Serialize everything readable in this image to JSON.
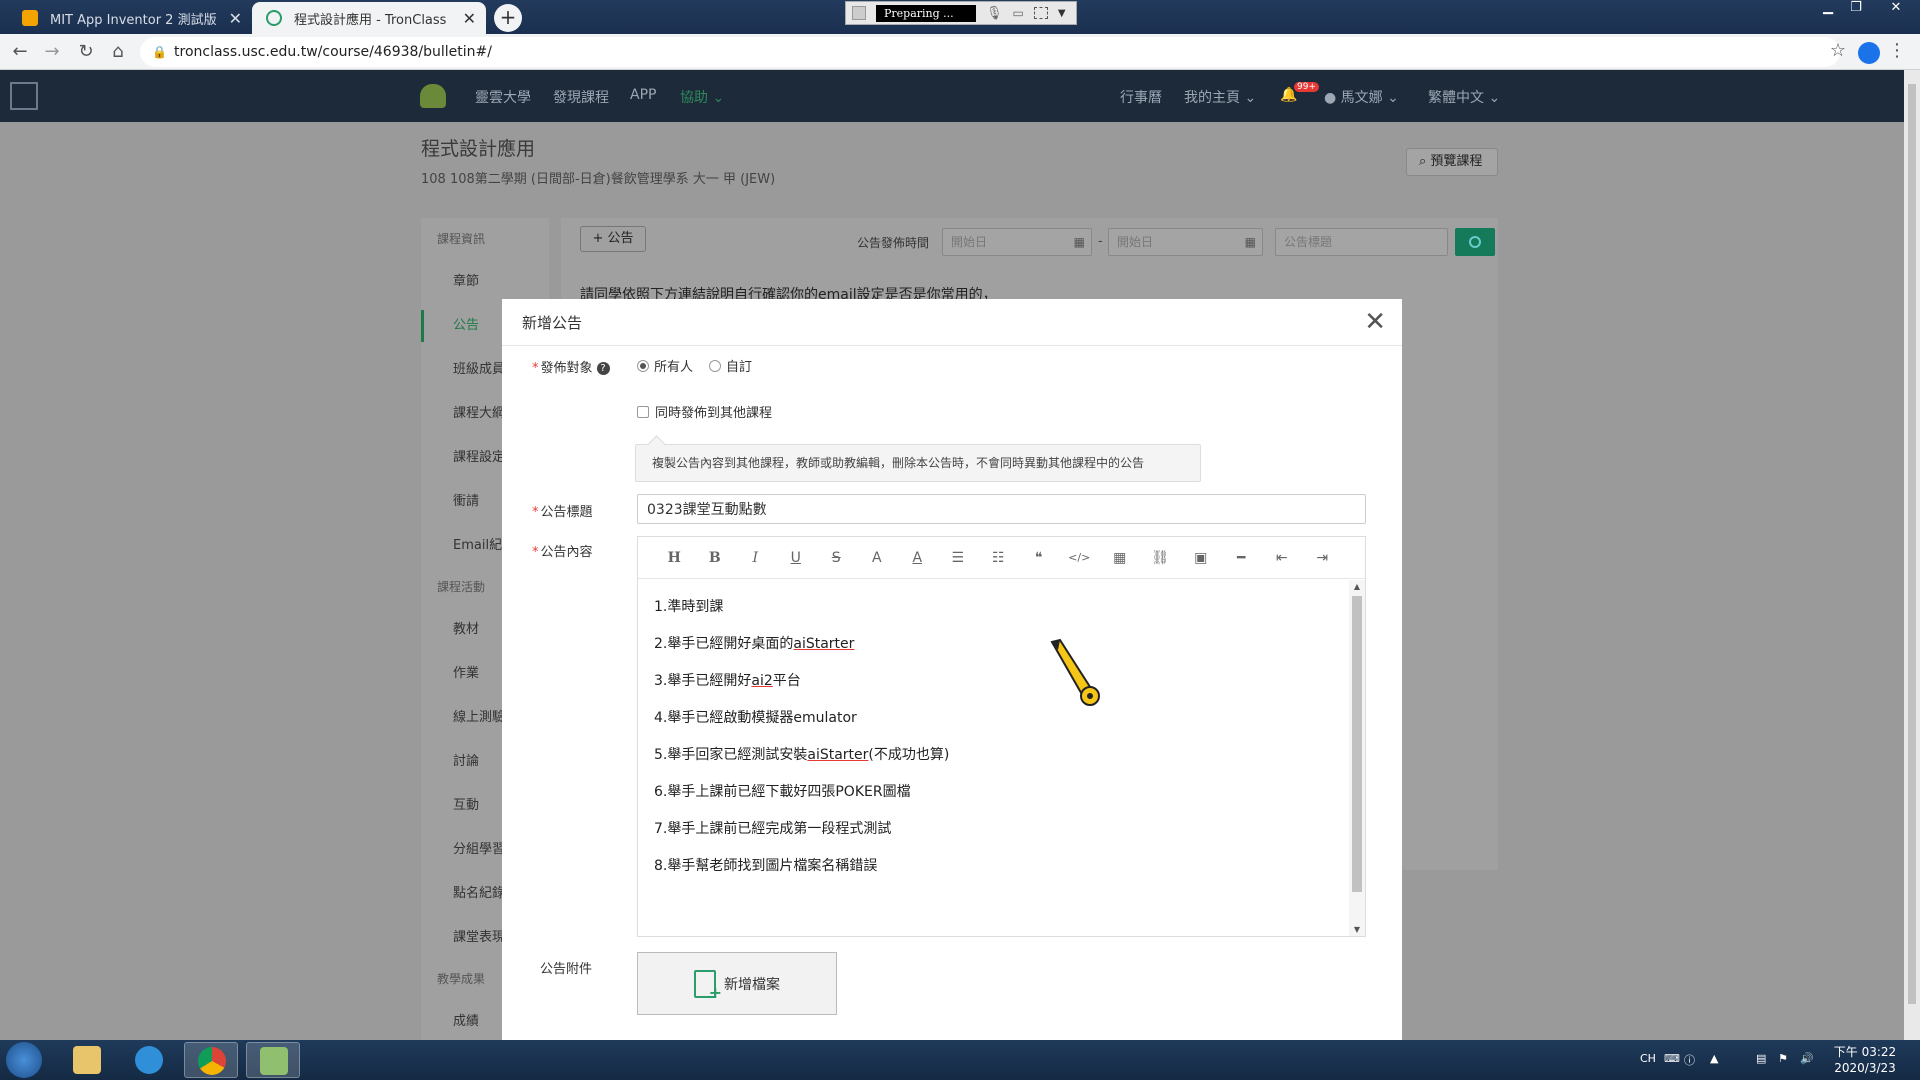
{
  "browser": {
    "tabs": [
      {
        "title": "MIT App Inventor 2 測試版",
        "active": false
      },
      {
        "title": "程式設計應用 - TronClass",
        "active": true
      }
    ],
    "recorder_label": "Preparing ...",
    "url": "tronclass.usc.edu.tw/course/46938/bulletin#/"
  },
  "site_nav": {
    "links": [
      "靈雲大學",
      "發現課程",
      "APP",
      "協助"
    ],
    "right": [
      "行事曆",
      "我的主頁",
      "99+",
      "馬文娜",
      "繁體中文"
    ]
  },
  "course": {
    "title": "程式設計應用",
    "subtitle": "108 108第二學期 (日間部-日倉)餐飲管理學系 大一 甲 (JEW)",
    "preview_button": "預覽課程"
  },
  "sidebar": {
    "section1": "課程資訊",
    "items1": [
      "章節",
      "公告",
      "班級成員",
      "課程大綱",
      "課程設定",
      "衝請",
      "Email紀錄"
    ],
    "section2": "課程活動",
    "items2": [
      "教材",
      "作業",
      "線上測驗",
      "討論",
      "互動",
      "分組學習",
      "點名紀錄",
      "課堂表現"
    ],
    "section3": "教學成果",
    "items3": [
      "成績"
    ]
  },
  "toolbar_bg": {
    "add_button": "+ 公告",
    "date_label": "公告發佈時間",
    "date_start_placeholder": "開始日",
    "date_end_placeholder": "開始日",
    "keyword_placeholder": "公告標題"
  },
  "notice_line": "請同學依照下方連結說明自行確認你的email設定是否是你常用的，",
  "modal": {
    "title": "新增公告",
    "target_label": "發佈對象",
    "target_options": [
      "所有人",
      "自訂"
    ],
    "also_publish_label": "同時發佈到其他課程",
    "tooltip": "複製公告內容到其他課程，教師或助教編輯，刪除本公告時，不會同時異動其他課程中的公告",
    "title_label": "公告標題",
    "title_value": "0323課堂互動點數",
    "content_label": "公告內容",
    "content_lines": [
      [
        "1.準時到課"
      ],
      [
        "2.舉手已經開好桌面的",
        "aiStarter",
        ""
      ],
      [
        "3.舉手已經開好",
        "ai2",
        "平台"
      ],
      [
        "4.舉手已經啟動模擬器emulator"
      ],
      [
        "5.舉手回家已經測試安裝",
        "aiStarter",
        "(不成功也算)"
      ],
      [
        "6.舉手上課前已經下載好四張POKER圖檔"
      ],
      [
        "7.舉手上課前已經完成第一段程式測試"
      ],
      [
        "8.舉手幫老師找到圖片檔案名稱錯誤"
      ]
    ],
    "attachment_label": "公告附件",
    "add_file_button": "新增檔案"
  },
  "taskbar": {
    "lang": "CH",
    "time": "下午 03:22",
    "date": "2020/3/23"
  },
  "colors": {
    "accent_green": "#2a9d6a",
    "nav_bg": "#1d2a3a",
    "required_red": "#e53935"
  }
}
